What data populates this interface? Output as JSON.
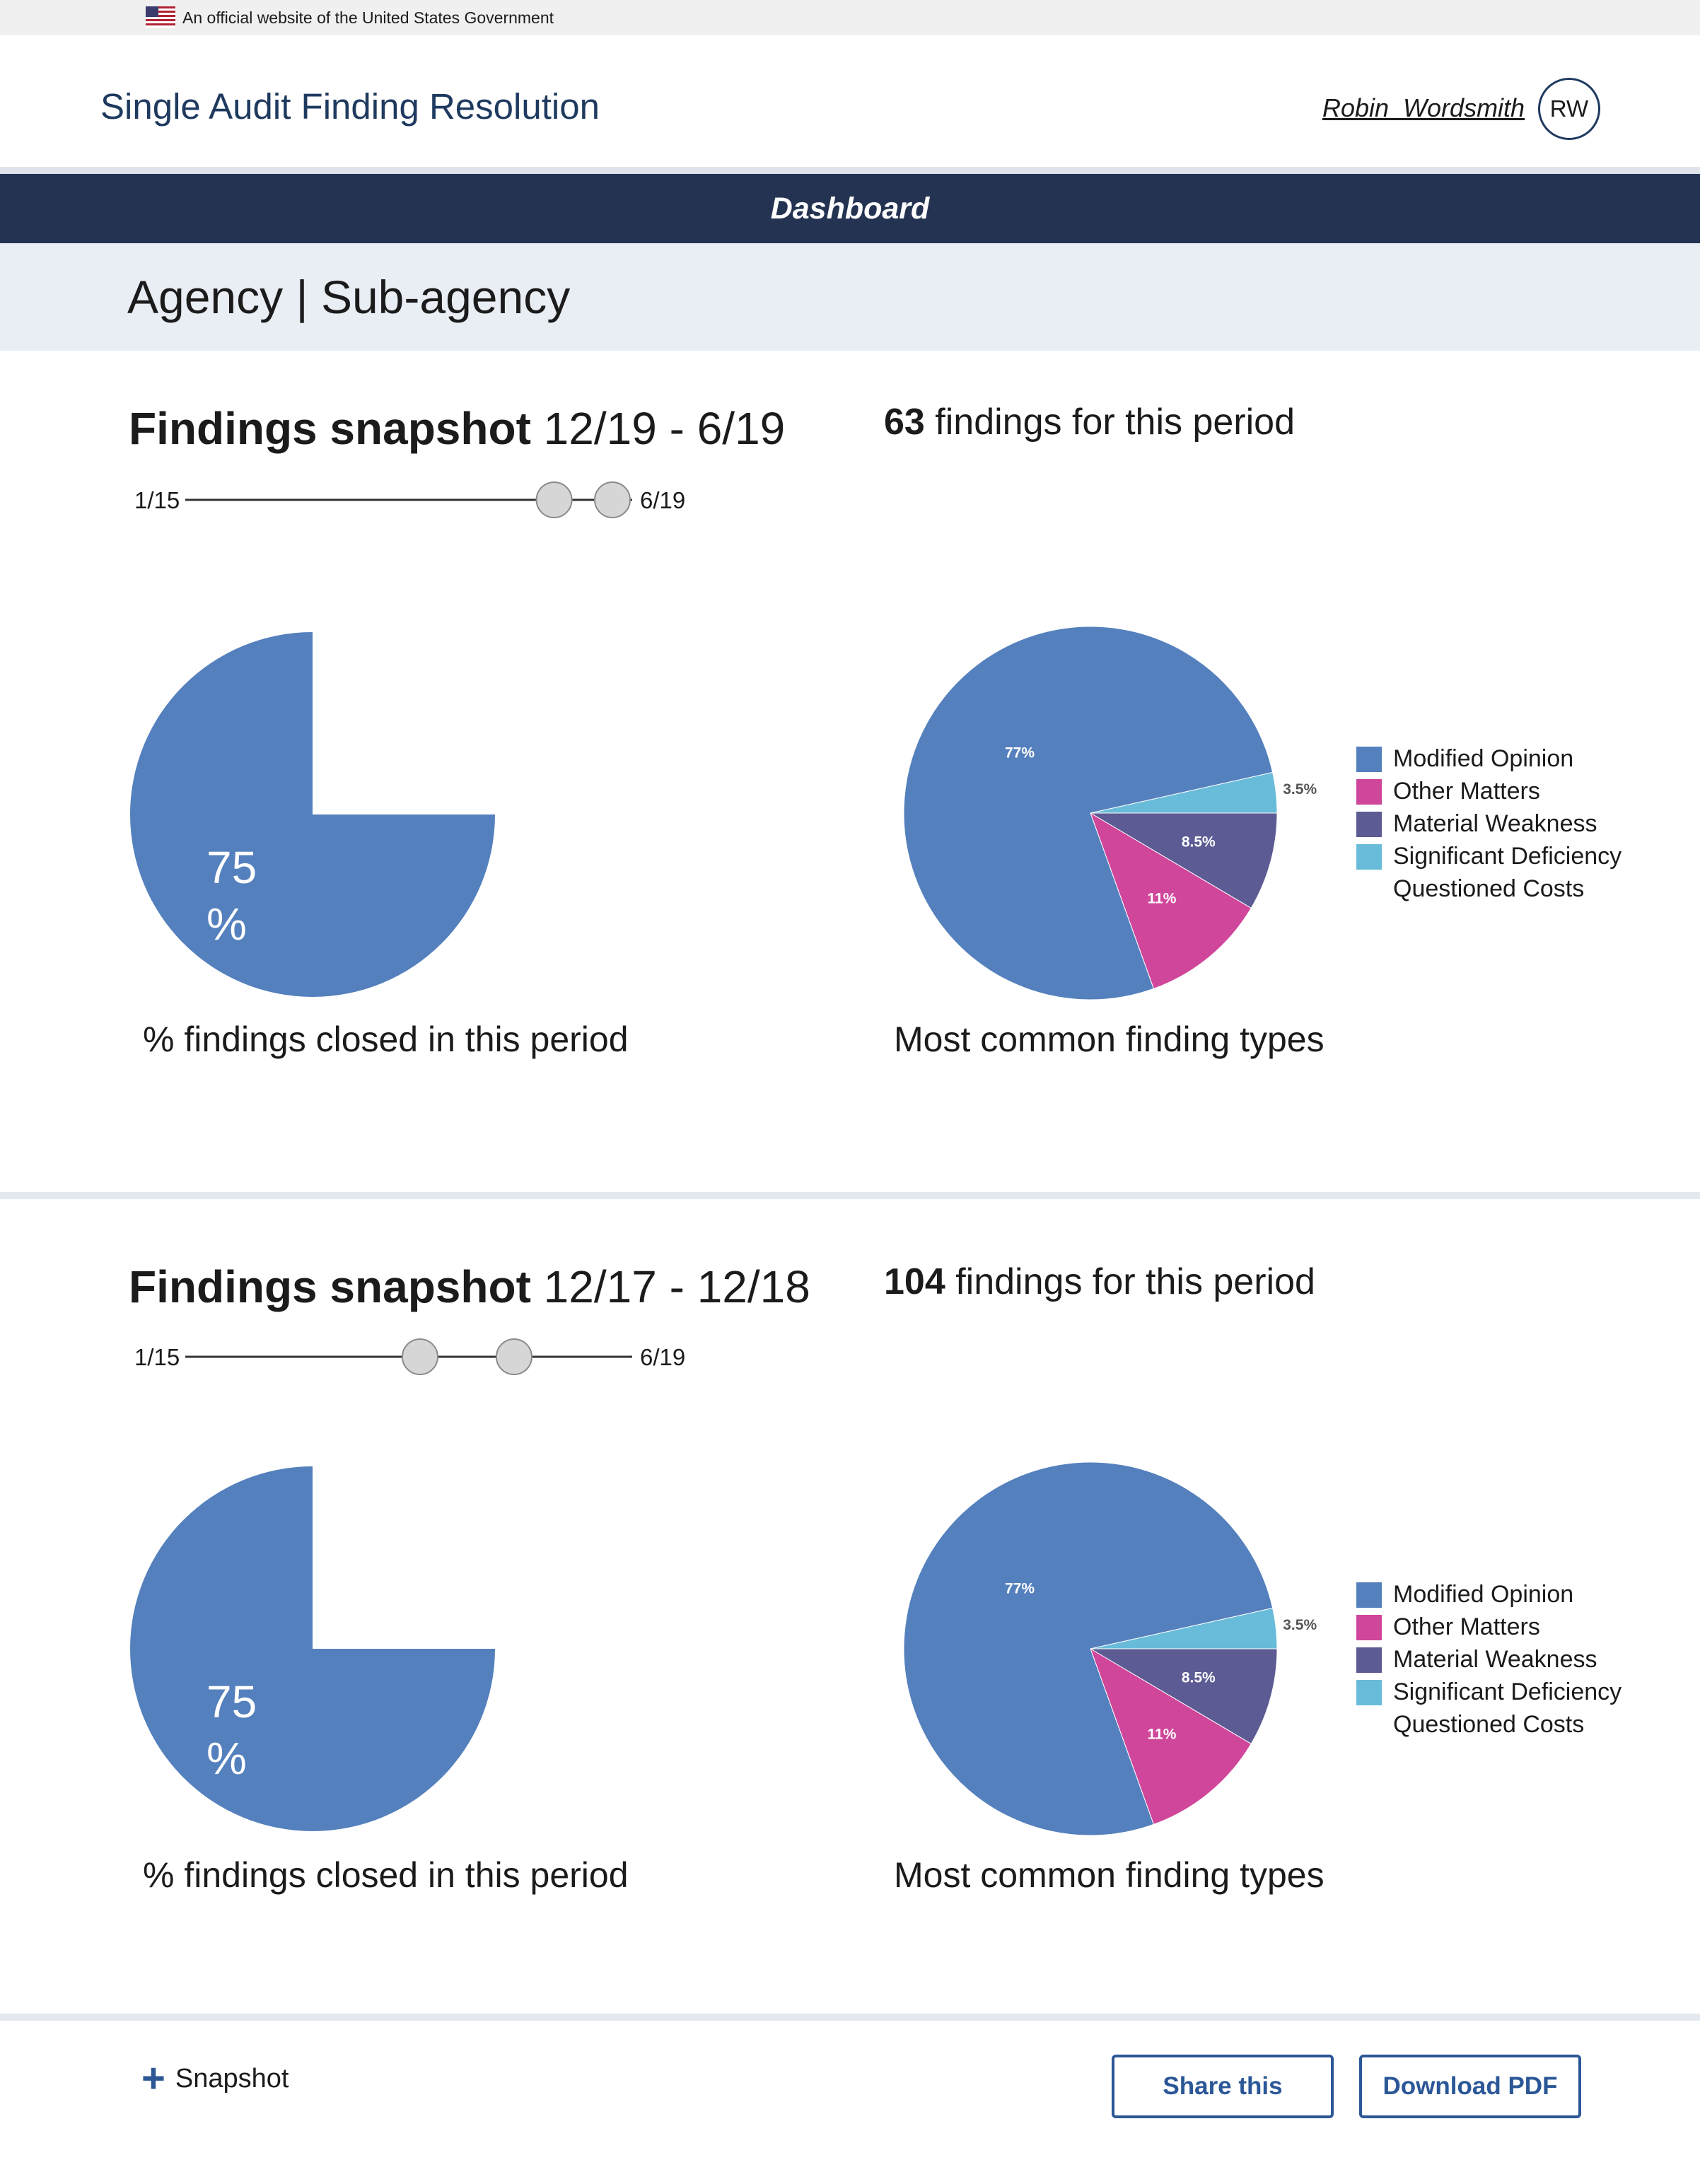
{
  "gov_banner": {
    "text": "An official website of the United States Government",
    "flag_icon": "us-flag-icon"
  },
  "header": {
    "site_title": "Single Audit Finding Resolution",
    "user_name": "Robin  Wordsmith",
    "user_initials": "RW"
  },
  "nav": {
    "dashboard_label": "Dashboard"
  },
  "agency": {
    "title": "Agency | Sub-agency"
  },
  "colors": {
    "navy": "#243352",
    "modified_opinion": "#5480bd",
    "other_matters": "#d0469a",
    "material_weakness": "#5c5b94",
    "significant_deficiency": "#69bcd9",
    "accent": "#2b5797"
  },
  "snapshots": [
    {
      "heading_bold": "Findings snapshot",
      "heading_range": " 12/19 - 6/19",
      "count": "63",
      "count_suffix": " findings for this period",
      "range_start": "1/15",
      "range_end": "6/19",
      "closed_pct_value": "75",
      "closed_pct_sign": "%",
      "closed_caption": "% findings closed in this period",
      "types_caption": "Most common finding types"
    },
    {
      "heading_bold": "Findings snapshot",
      "heading_range": " 12/17 - 12/18",
      "count": "104",
      "count_suffix": " findings for this period",
      "range_start": "1/15",
      "range_end": "6/19",
      "closed_pct_value": "75",
      "closed_pct_sign": "%",
      "closed_caption": "% findings closed in this period",
      "types_caption": "Most common finding types"
    }
  ],
  "chart_data": [
    {
      "type": "pie",
      "title": "% findings closed in this period",
      "values": [
        75,
        25
      ],
      "labels": [
        "75\n%",
        ""
      ],
      "colors": [
        "#5480bd",
        "#ffffff"
      ]
    },
    {
      "type": "pie",
      "title": "Most common finding types",
      "categories": [
        "Modified Opinion",
        "Other Matters",
        "Material Weakness",
        "Significant Deficiency"
      ],
      "values": [
        77,
        11,
        8.5,
        3.5
      ],
      "data_labels": [
        "77%",
        "11%",
        "8.5%",
        "3.5%"
      ],
      "legend": [
        "Modified Opinion",
        "Other Matters",
        "Material Weakness",
        "Significant Deficiency",
        "Questioned Costs"
      ],
      "legend_placement": "right"
    },
    {
      "type": "pie",
      "title": "% findings closed in this period",
      "values": [
        75,
        25
      ],
      "labels": [
        "75\n%",
        ""
      ],
      "colors": [
        "#5480bd",
        "#ffffff"
      ]
    },
    {
      "type": "pie",
      "title": "Most common finding types",
      "categories": [
        "Modified Opinion",
        "Other Matters",
        "Material Weakness",
        "Significant Deficiency"
      ],
      "values": [
        77,
        11,
        8.5,
        3.5
      ],
      "data_labels": [
        "77%",
        "11%",
        "8.5%",
        "3.5%"
      ],
      "legend": [
        "Modified Opinion",
        "Other Matters",
        "Material Weakness",
        "Significant Deficiency",
        "Questioned Costs"
      ],
      "legend_placement": "right"
    }
  ],
  "slider_positions": [
    {
      "low": 0.83,
      "high": 1.0
    },
    {
      "low": 0.53,
      "high": 0.78
    }
  ],
  "footer": {
    "add_snapshot_label": "Snapshot",
    "share_label": "Share this",
    "download_label": "Download PDF"
  }
}
